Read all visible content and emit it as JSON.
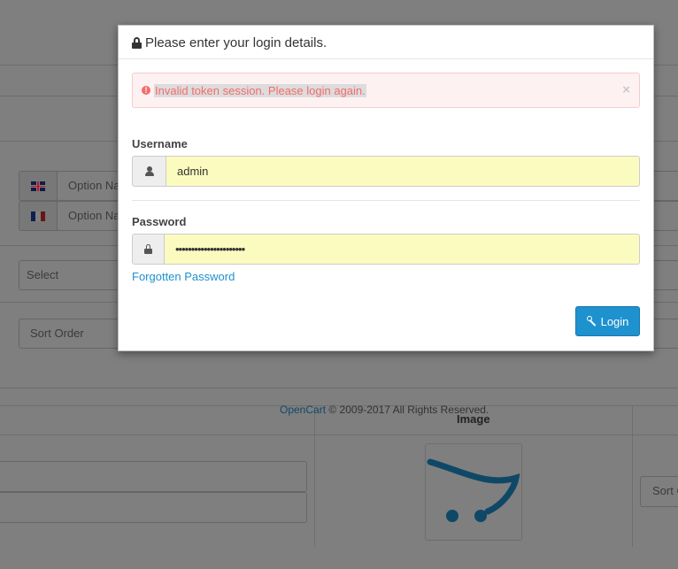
{
  "background": {
    "option_name_1": "Option Na",
    "option_name_2": "Option Na",
    "select_value": "Select",
    "sort_order_placeholder": "Sort Order",
    "sort_order_short": "Sort O",
    "footer": {
      "brand": "OpenCart",
      "text": " © 2009-2017 All Rights Reserved."
    },
    "image_column_header": "Image",
    "flags": [
      "gb-flag-icon",
      "fr-flag-icon"
    ]
  },
  "modal": {
    "title": "Please enter your login details.",
    "alert": {
      "message": "Invalid token session. Please login again.",
      "close_label": "×"
    },
    "username": {
      "label": "Username",
      "value": "admin"
    },
    "password": {
      "label": "Password",
      "value": "••••••••••••••••••••••"
    },
    "forgot_link": "Forgotten Password",
    "login_button": "Login"
  },
  "colors": {
    "primary": "#1e91cf",
    "alert_text": "#f56b6b",
    "alert_bg": "#fdf1f1",
    "input_autofill": "#fbfbbf"
  }
}
